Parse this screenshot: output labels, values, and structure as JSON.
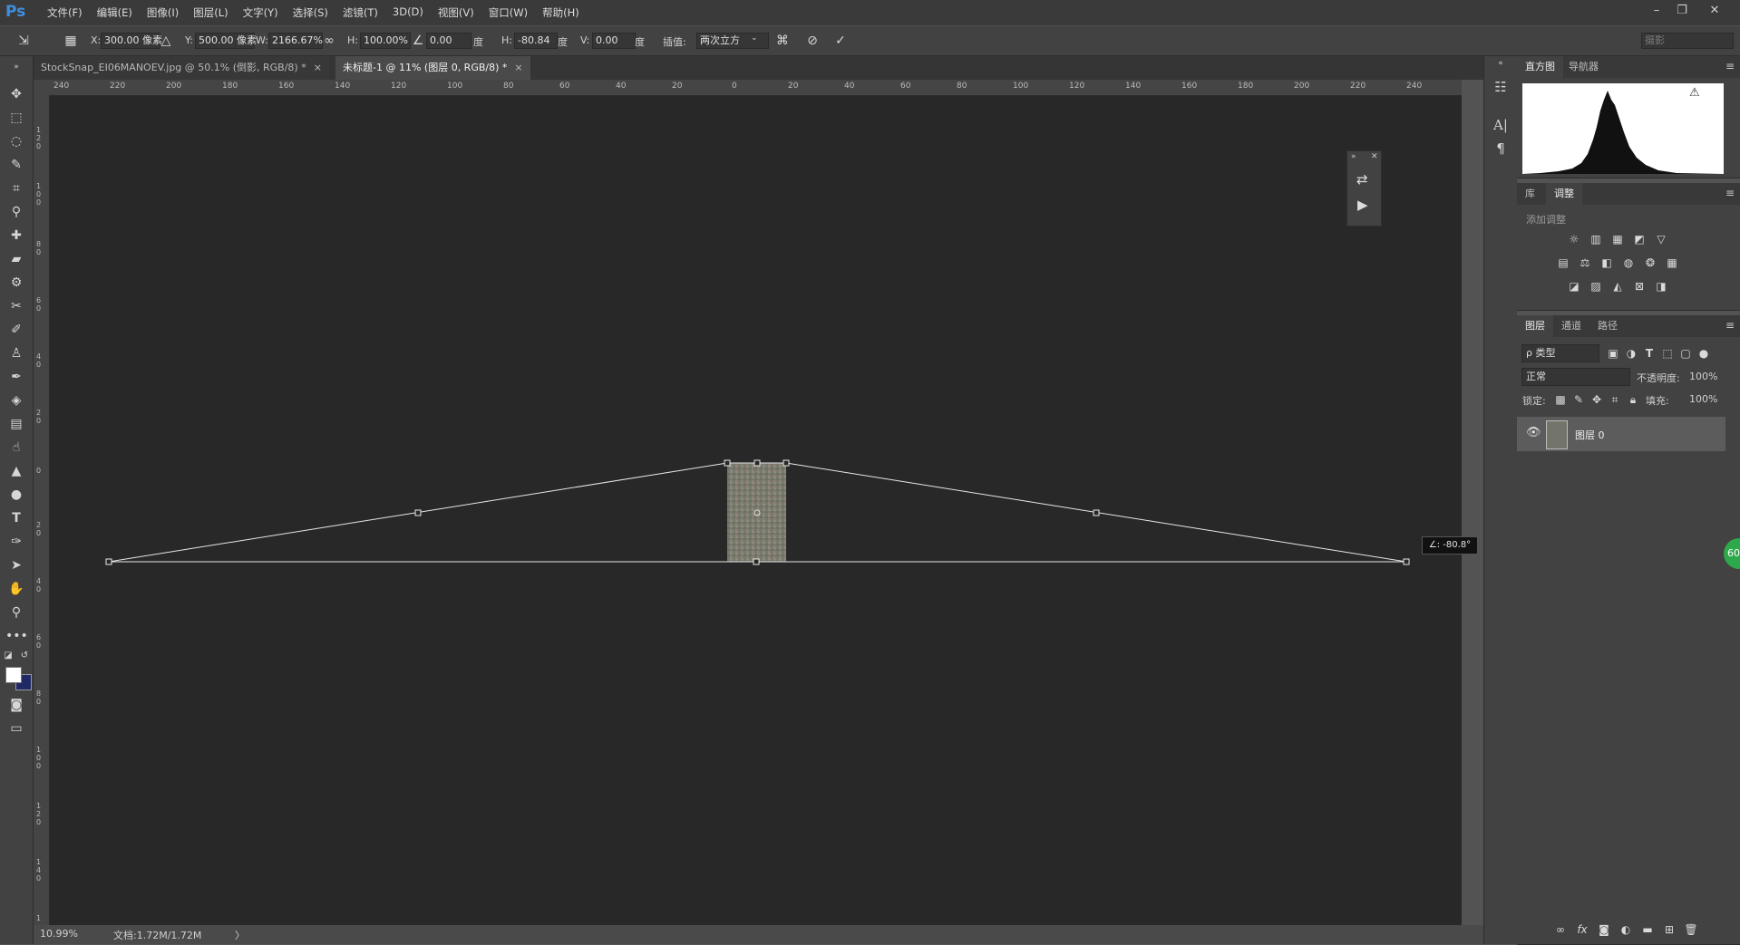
{
  "app": {
    "logo": "Ps"
  },
  "menu": [
    "文件(F)",
    "编辑(E)",
    "图像(I)",
    "图层(L)",
    "文字(Y)",
    "选择(S)",
    "滤镜(T)",
    "3D(D)",
    "视图(V)",
    "窗口(W)",
    "帮助(H)"
  ],
  "window_controls": {
    "minimize": "–",
    "restore": "❐",
    "close": "✕"
  },
  "options": {
    "x_label": "X:",
    "x_value": "300.00 像素",
    "y_label": "Y:",
    "y_value": "500.00 像素",
    "w_label": "W:",
    "w_value": "2166.67%",
    "h_label": "H:",
    "h_value": "100.00%",
    "angle_value": "0.00",
    "angle_unit": "度",
    "hskew_label": "H:",
    "hskew_value": "-80.84",
    "hskew_unit": "度",
    "vskew_label": "V:",
    "vskew_value": "0.00",
    "vskew_unit": "度",
    "interp_label": "插值:",
    "interp_value": "两次立方",
    "search_placeholder": "摄影"
  },
  "tabs": [
    {
      "label": "StockSnap_EI06MANOEV.jpg @ 50.1% (倒影, RGB/8) *",
      "active": false
    },
    {
      "label": "未标题-1 @ 11% (图层 0, RGB/8) *",
      "active": true
    }
  ],
  "ruler_top": [
    "240",
    "220",
    "200",
    "180",
    "160",
    "140",
    "120",
    "100",
    "80",
    "60",
    "40",
    "20",
    "0",
    "20",
    "40",
    "60",
    "80",
    "100",
    "120",
    "140",
    "160",
    "180",
    "200",
    "220",
    "240"
  ],
  "ruler_left": [
    "1 2 0",
    "1 0 0",
    "8 0",
    "6 0",
    "4 0",
    "2 0",
    "0",
    "2 0",
    "4 0",
    "6 0",
    "8 0",
    "1 0 0",
    "1 2 0",
    "1 4 0",
    "1"
  ],
  "tooltip": "∠: -80.8°",
  "status": {
    "zoom": "10.99%",
    "doc": "文档:1.72M/1.72M",
    "arrow": "〉"
  },
  "panels": {
    "top_tabs": [
      "直方图",
      "导航器"
    ],
    "adj_tabs": [
      "库",
      "调整"
    ],
    "adj_title": "添加调整",
    "layer_tabs": [
      "图层",
      "通道",
      "路径"
    ],
    "filter_kind": "ρ 类型",
    "blend_mode": "正常",
    "opacity_label": "不透明度:",
    "opacity_value": "100%",
    "lock_label": "锁定:",
    "fill_label": "填充:",
    "fill_value": "100%",
    "layer_name": "图层 0",
    "green_badge": "60"
  },
  "colors": {
    "accent": "#3e8ee0",
    "canvas": "#282829",
    "panel": "#424242",
    "foreground": "#ffffff",
    "background": "#1f2a66"
  }
}
